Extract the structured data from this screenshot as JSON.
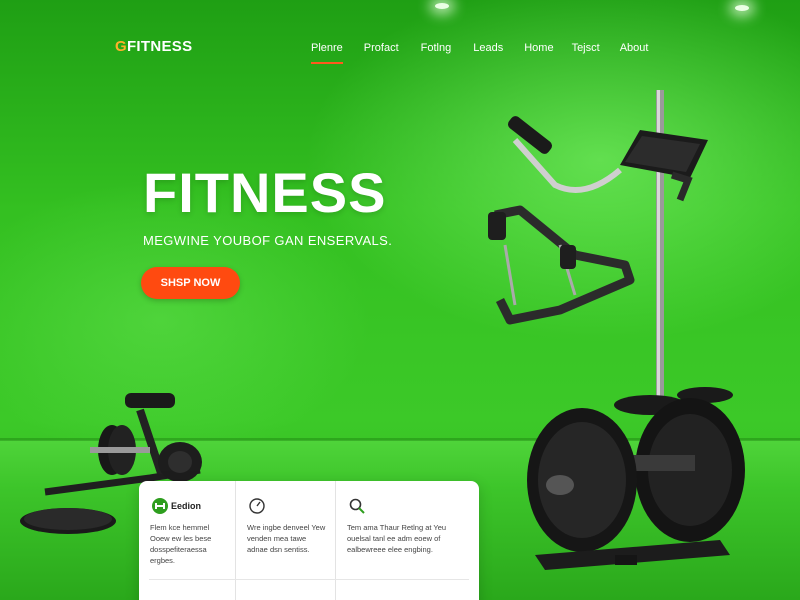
{
  "header": {
    "logo_mark": "G",
    "logo_text": "FITNESS",
    "nav": [
      {
        "label": "Plenre",
        "active": true
      },
      {
        "label": "Profact",
        "active": false
      },
      {
        "label": "Fotlng",
        "active": false
      },
      {
        "label": "Leads",
        "active": false
      },
      {
        "label": "Home",
        "active": false
      },
      {
        "label": "Tejsct",
        "active": false
      },
      {
        "label": "About",
        "active": false
      }
    ]
  },
  "hero": {
    "title": "FITNESS",
    "subtitle": "MEGWINE YOUBOF GAN ENSERVALS.",
    "cta_label": "SHSP NOW"
  },
  "features": [
    {
      "icon": "dumbbell-icon",
      "title": "Eedion",
      "text": "Flem kce hemmel Ooew ew les bese dosspefiteraessa ergbes."
    },
    {
      "icon": "gauge-icon",
      "title": "",
      "text": "Wre ingbe denveel Yew venden mea tawe adnae dsn sentiss."
    },
    {
      "icon": "search-icon",
      "title": "",
      "text": "Tem ama Thaur Retlng at Yeu ouelsal tanl ee adm eoew of ealbewreee elee engbing."
    }
  ],
  "colors": {
    "accent": "#ff4a10",
    "background_green": "#3cc928",
    "feature_icon_green": "#2e9e1e"
  }
}
